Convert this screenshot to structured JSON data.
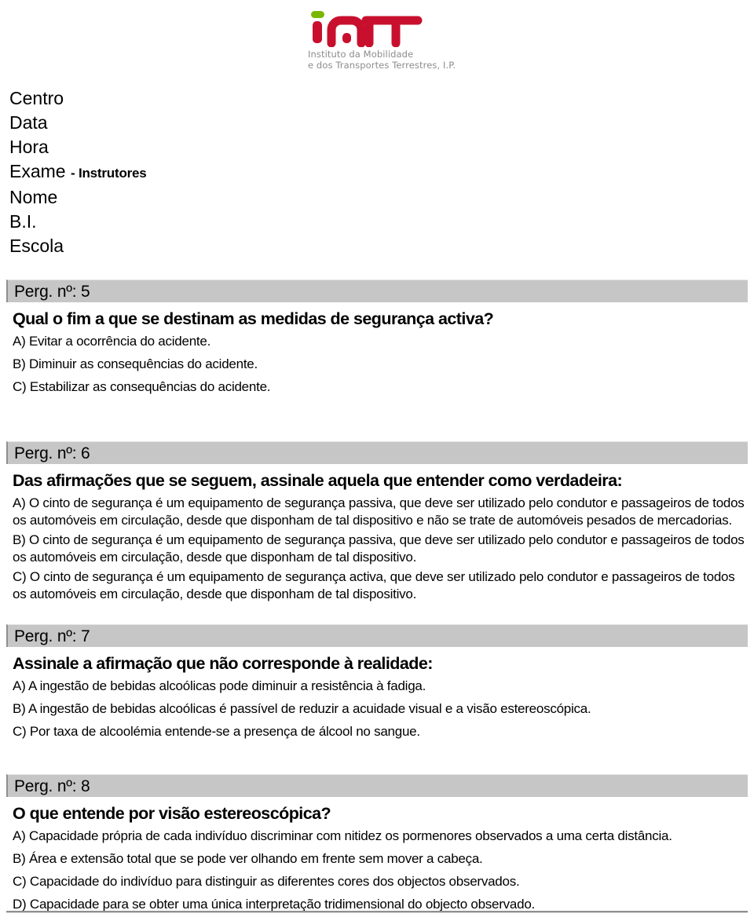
{
  "logo": {
    "name": "imtt-logo",
    "mark_text": "imTT",
    "accent_color": "#c8102e",
    "dot_color": "#7ab800",
    "tagline": "Instituto da Mobilidade\ne dos Transportes Terrestres, I.P.",
    "tagline_color": "#8c8c8c"
  },
  "header": {
    "fields": [
      {
        "label": "Centro",
        "suffix": ""
      },
      {
        "label": "Data",
        "suffix": ""
      },
      {
        "label": "Hora",
        "suffix": ""
      },
      {
        "label": "Exame",
        "suffix": "- Instrutores"
      },
      {
        "label": "Nome",
        "suffix": ""
      },
      {
        "label": "B.I.",
        "suffix": ""
      },
      {
        "label": "Escola",
        "suffix": ""
      }
    ]
  },
  "questions": [
    {
      "bar_label": "Perg. nº: 5",
      "number": "5",
      "title": "Qual o fim a que se destinam as medidas de segurança activa?",
      "options": [
        "A) Evitar a ocorrência do acidente.",
        "B) Diminuir as consequências do acidente.",
        "C) Estabilizar as consequências do acidente."
      ]
    },
    {
      "bar_label": "Perg. nº: 6",
      "number": "6",
      "title": "Das afirmações que se seguem, assinale aquela que entender como verdadeira:",
      "options": [
        "A) O cinto de segurança é um equipamento de segurança passiva, que deve ser utilizado pelo condutor e passageiros de todos os automóveis em circulação, desde que disponham de tal dispositivo e não se trate de automóveis pesados de mercadorias.",
        "B) O cinto de segurança é um equipamento de segurança passiva, que deve ser utilizado pelo condutor e passageiros de todos os automóveis em circulação, desde que disponham de tal dispositivo.",
        "C) O cinto de segurança é um equipamento de segurança activa, que deve ser utilizado pelo condutor e passageiros de todos os automóveis em circulação, desde que disponham de tal dispositivo."
      ]
    },
    {
      "bar_label": "Perg. nº: 7",
      "number": "7",
      "title": "Assinale a afirmação que não corresponde à realidade:",
      "options": [
        "A) A ingestão de bebidas alcoólicas pode diminuir a resistência à fadiga.",
        "B) A ingestão de bebidas alcoólicas é passível de reduzir a acuidade visual e a visão estereoscópica.",
        "C) Por taxa de alcoolémia entende-se a presença de álcool no sangue."
      ]
    },
    {
      "bar_label": "Perg. nº: 8",
      "number": "8",
      "title": "O que entende por visão estereoscópica?",
      "options": [
        "A) Capacidade própria de cada indivíduo discriminar com nitidez os pormenores observados a uma certa distância.",
        "B) Área e extensão total que se pode ver olhando em frente sem mover a cabeça.",
        "C) Capacidade do indivíduo para distinguir as diferentes cores dos objectos observados.",
        "D) Capacidade para se obter uma única interpretação tridimensional do objecto observado."
      ]
    }
  ],
  "colors": {
    "bar_background": "#c6c6c6",
    "bar_border": "#8f8f8f",
    "page_background": "#ffffff",
    "text": "#000000"
  }
}
